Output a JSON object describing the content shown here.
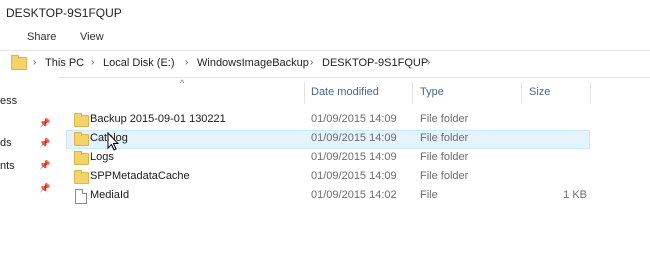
{
  "window": {
    "title": "DESKTOP-9S1FQUP"
  },
  "ribbon": {
    "tabs": [
      "Share",
      "View"
    ]
  },
  "breadcrumb": {
    "items": [
      "This PC",
      "Local Disk (E:)",
      "WindowsImageBackup",
      "DESKTOP-9S1FQUP"
    ]
  },
  "nav": {
    "items": [
      "ess",
      "ds",
      "nts"
    ]
  },
  "columns": {
    "name": "",
    "date": "Date modified",
    "type": "Type",
    "size": "Size"
  },
  "files": [
    {
      "name": "Backup 2015-09-01 130221",
      "date": "01/09/2015 14:09",
      "type": "File folder",
      "size": "",
      "icon": "folder-icon"
    },
    {
      "name": "Catalog",
      "date": "01/09/2015 14:09",
      "type": "File folder",
      "size": "",
      "icon": "folder-icon"
    },
    {
      "name": "Logs",
      "date": "01/09/2015 14:09",
      "type": "File folder",
      "size": "",
      "icon": "folder-icon"
    },
    {
      "name": "SPPMetadataCache",
      "date": "01/09/2015 14:09",
      "type": "File folder",
      "size": "",
      "icon": "folder-icon"
    },
    {
      "name": "MediaId",
      "date": "01/09/2015 14:02",
      "type": "File",
      "size": "1 KB",
      "icon": "file-icon"
    }
  ],
  "colors": {
    "hover_row": "#e5f3ff",
    "header_text": "#4d6785",
    "folder": "#f3d36b"
  }
}
